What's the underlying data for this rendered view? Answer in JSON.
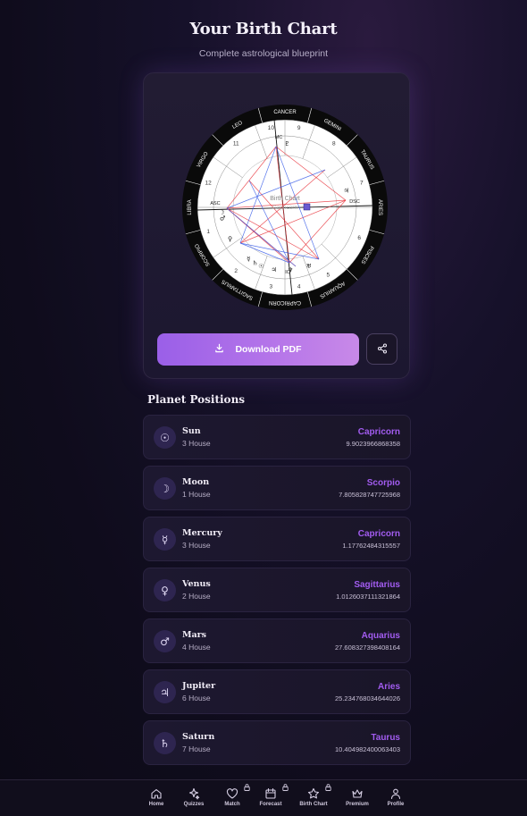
{
  "header": {
    "title": "Your Birth Chart",
    "subtitle": "Complete astrological blueprint"
  },
  "chart": {
    "center_title": "Birth Chart",
    "center_subtitle": "Capricorn",
    "signs": [
      "LEO",
      "CANCER",
      "GEMINI",
      "TAURUS",
      "ARIES",
      "PISCES",
      "AQUARIUS",
      "CAPRICORN",
      "SAGITTARIUS",
      "SCORPIO",
      "LIBRA",
      "VIRGO"
    ],
    "houses": [
      "1",
      "2",
      "3",
      "4",
      "5",
      "6",
      "7",
      "8",
      "9",
      "10",
      "11",
      "12"
    ],
    "angles": {
      "asc": "ASC",
      "dsc": "DSC",
      "mc": "MC",
      "ic": "IC"
    },
    "colors": {
      "ring": "#0a0a0a",
      "face": "#ffffff",
      "red_aspect": "#e8343c",
      "blue_aspect": "#3a5ee8"
    }
  },
  "actions": {
    "download_label": "Download PDF",
    "download_icon": "download-icon",
    "share_icon": "share-icon"
  },
  "planets_section": {
    "title": "Planet Positions",
    "planets": [
      {
        "name": "Sun",
        "house": "3 House",
        "sign": "Capricorn",
        "degree": "9.9023966868358",
        "glyph": "☉"
      },
      {
        "name": "Moon",
        "house": "1 House",
        "sign": "Scorpio",
        "degree": "7.805828747725968",
        "glyph": "☽"
      },
      {
        "name": "Mercury",
        "house": "3 House",
        "sign": "Capricorn",
        "degree": "1.17762484315557",
        "glyph": "☿"
      },
      {
        "name": "Venus",
        "house": "2 House",
        "sign": "Sagittarius",
        "degree": "1.0126037111321864",
        "glyph": "♀"
      },
      {
        "name": "Mars",
        "house": "4 House",
        "sign": "Aquarius",
        "degree": "27.608327398408164",
        "glyph": "♂"
      },
      {
        "name": "Jupiter",
        "house": "6 House",
        "sign": "Aries",
        "degree": "25.234768034644026",
        "glyph": "♃"
      },
      {
        "name": "Saturn",
        "house": "7 House",
        "sign": "Taurus",
        "degree": "10.404982400063403",
        "glyph": "♄"
      }
    ]
  },
  "nav": {
    "items": [
      {
        "label": "Home",
        "icon": "home-icon",
        "locked": false
      },
      {
        "label": "Quizzes",
        "icon": "sparkles-icon",
        "locked": false
      },
      {
        "label": "Match",
        "icon": "heart-icon",
        "locked": true
      },
      {
        "label": "Forecast",
        "icon": "calendar-icon",
        "locked": true
      },
      {
        "label": "Birth Chart",
        "icon": "star-icon",
        "locked": true
      },
      {
        "label": "Premium",
        "icon": "crown-icon",
        "locked": false
      },
      {
        "label": "Profile",
        "icon": "user-icon",
        "locked": false
      }
    ]
  }
}
